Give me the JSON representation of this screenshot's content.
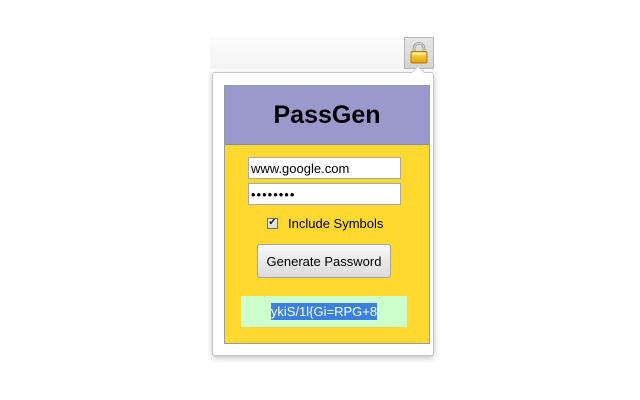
{
  "toolbar": {
    "extension_icon": "padlock-icon"
  },
  "popup": {
    "title": "PassGen",
    "site_field": {
      "value": "www.google.com",
      "placeholder": ""
    },
    "password_field": {
      "value": "••••••••",
      "placeholder": ""
    },
    "include_symbols": {
      "label": "Include Symbols",
      "checked": true,
      "check_glyph": "✔"
    },
    "generate_button": {
      "label": "Generate Password"
    },
    "result": {
      "value": "ykiS/1l{Gi=RPG+8"
    }
  },
  "colors": {
    "header_bg": "#9b98cc",
    "body_bg": "#ffd92f",
    "result_bg": "#ccffcc",
    "selection": "#3a80e0"
  }
}
